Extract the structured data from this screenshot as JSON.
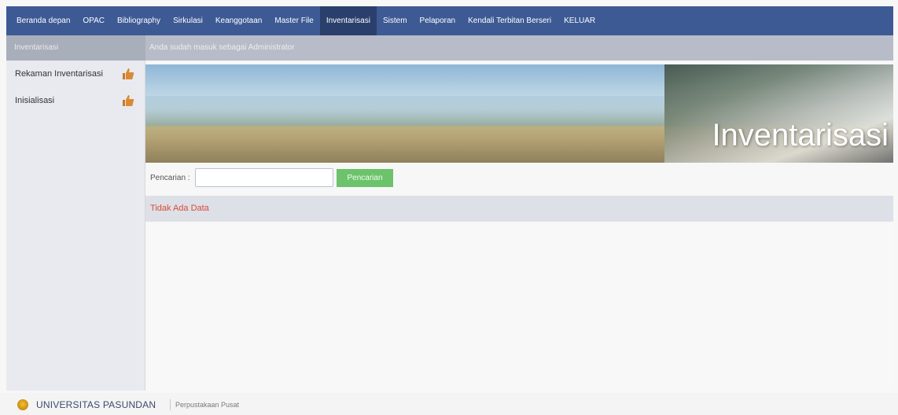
{
  "nav": {
    "items": [
      "Beranda depan",
      "OPAC",
      "Bibliography",
      "Sirkulasi",
      "Keanggotaan",
      "Master File",
      "Inventarisasi",
      "Sistem",
      "Pelaporan",
      "Kendali Terbitan Berseri",
      "KELUAR"
    ],
    "active": "Inventarisasi"
  },
  "subbar": {
    "section": "Inventarisasi",
    "message": "Anda sudah masuk sebagai Administrator"
  },
  "sidebar": {
    "items": [
      {
        "label": "Rekaman Inventarisasi",
        "icon": "thumbs-up-icon"
      },
      {
        "label": "Inisialisasi",
        "icon": "thumbs-up-icon"
      }
    ]
  },
  "banner": {
    "title": "Inventarisasi"
  },
  "search": {
    "label": "Pencarian :",
    "value": "",
    "button_label": "Pencarian"
  },
  "status": {
    "no_data": "Tidak Ada Data"
  },
  "footer": {
    "institution": "UNIVERSITAS PASUNDAN",
    "subtitle": "Perpustakaan Pusat"
  },
  "colors": {
    "nav_bg": "#3d5a94",
    "active_nav_bg": "#2a3f6b",
    "search_button": "#6cc36b",
    "no_data_text": "#d84a3a"
  }
}
